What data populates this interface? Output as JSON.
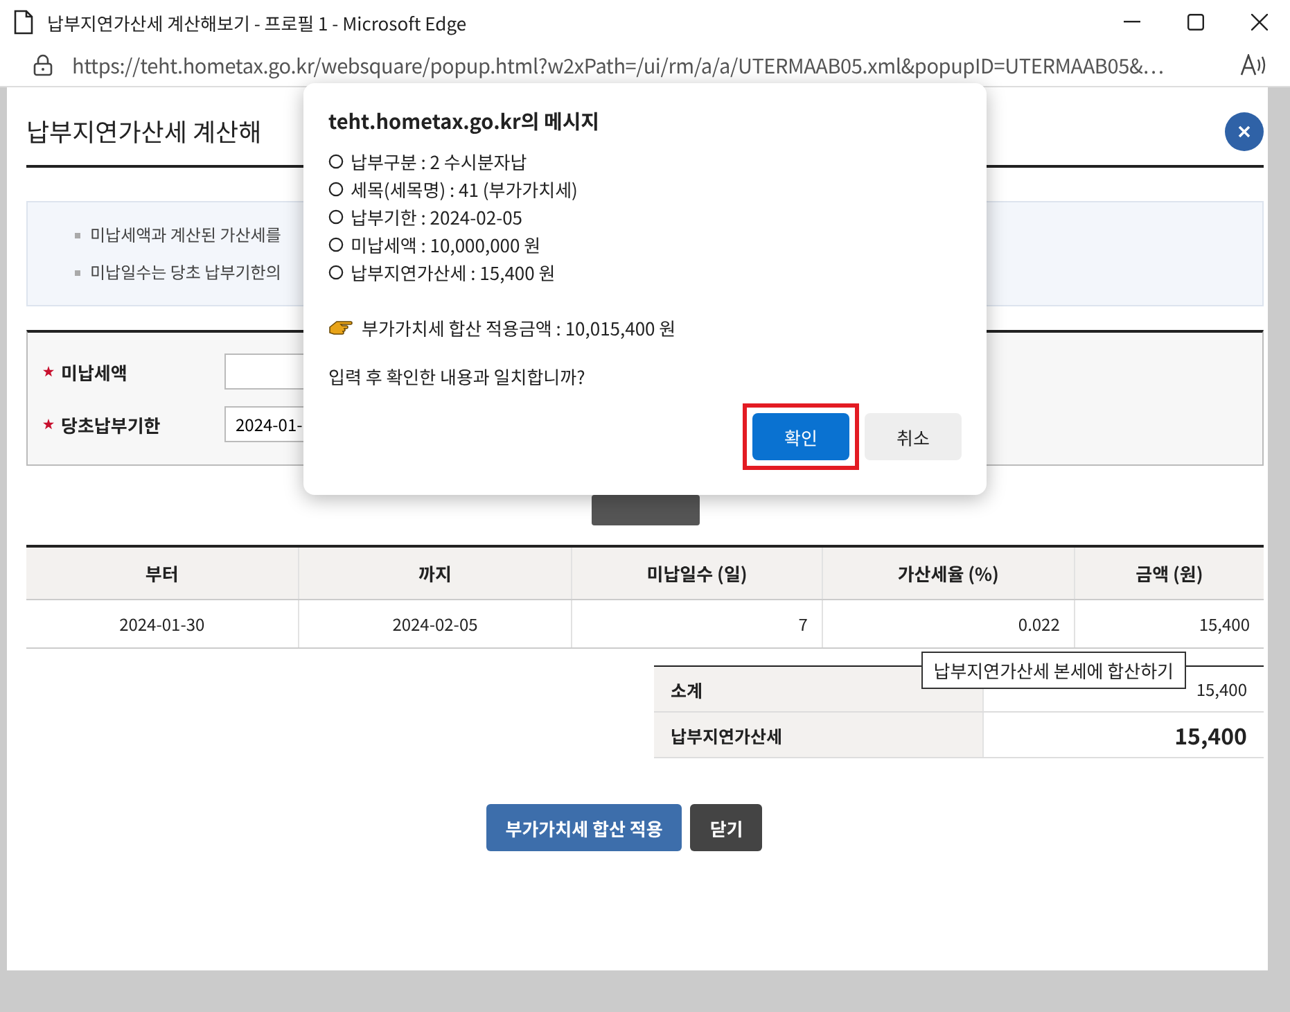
{
  "window": {
    "title": "납부지연가산세 계산해보기 - 프로필 1 - Microsoft Edge",
    "url": "https://teht.hometax.go.kr/websquare/popup.html?w2xPath=/ui/rm/a/a/UTERMAAB05.xml&popupID=UTERMAAB05&…"
  },
  "page": {
    "title": "납부지연가산세 계산해",
    "notes": [
      "미납세액과 계산된 가산세를",
      "미납일수는 당초 납부기한의"
    ],
    "form": [
      {
        "label": "미납세액",
        "required": true
      },
      {
        "label": "당초납부기한",
        "required": true,
        "value": "2024-01-"
      }
    ],
    "table": {
      "columns": [
        "부터",
        "까지",
        "미납일수 (일)",
        "가산세율 (%)",
        "금액 (원)"
      ],
      "rows": [
        [
          "2024-01-30",
          "2024-02-05",
          "7",
          "0.022",
          "15,400"
        ]
      ]
    },
    "summary": [
      {
        "label": "소계",
        "value": "15,400",
        "kind": "subtotal"
      },
      {
        "label": "납부지연가산세",
        "value": "15,400",
        "kind": "total"
      }
    ],
    "tooltip": "납부지연가산세 본세에 합산하기",
    "buttons": [
      {
        "label": "부가가치세 합산 적용",
        "kind": "primary"
      },
      {
        "label": "닫기",
        "kind": "dark"
      }
    ]
  },
  "dialog": {
    "title": "teht.hometax.go.kr의 메시지",
    "lines": [
      "납부구분 : 2 수시분자납",
      "세목(세목명) : 41 (부가가치세)",
      "납부기한 : 2024-02-05",
      "미납세액 : 10,000,000 원",
      "납부지연가산세 : 15,400 원"
    ],
    "applied": "부가가치세 합산 적용금액 : 10,015,400 원",
    "question": "입력 후 확인한 내용과 일치합니까?",
    "buttons": [
      {
        "label": "확인",
        "kind": "primary",
        "highlighted": true
      },
      {
        "label": "취소",
        "kind": "secondary",
        "highlighted": false
      }
    ]
  }
}
